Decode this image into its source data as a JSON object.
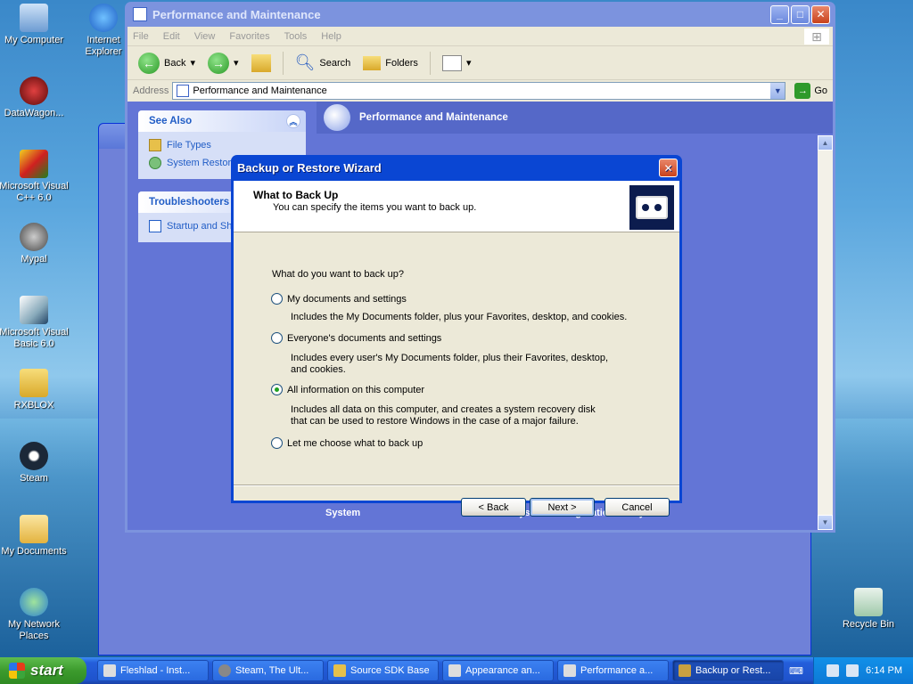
{
  "desktop": {
    "icons": [
      {
        "label": "My Computer"
      },
      {
        "label": "Internet Explorer"
      },
      {
        "label": "DataWagon..."
      },
      {
        "label": "Microsoft Visual C++ 6.0"
      },
      {
        "label": "Mypal"
      },
      {
        "label": "Microsoft Visual Basic 6.0"
      },
      {
        "label": "RXBLOX"
      },
      {
        "label": "Steam"
      },
      {
        "label": "My Documents"
      },
      {
        "label": "My Network Places"
      },
      {
        "label": "Recycle Bin"
      }
    ]
  },
  "explorer": {
    "title": "Performance and Maintenance",
    "menu": [
      "File",
      "Edit",
      "View",
      "Favorites",
      "Tools",
      "Help"
    ],
    "toolbar": {
      "back": "Back",
      "search": "Search",
      "folders": "Folders"
    },
    "address_label": "Address",
    "address_value": "Performance and Maintenance",
    "go_label": "Go",
    "see_also": {
      "title": "See Also",
      "items": [
        "File Types",
        "System Restore"
      ]
    },
    "troubleshooters": {
      "title": "Troubleshooters",
      "items": [
        "Startup and Shutdown"
      ]
    },
    "category_header": "Performance and Maintenance",
    "cut_items": [
      "System",
      "System Configuration Utility"
    ]
  },
  "wizard": {
    "title": "Backup or Restore Wizard",
    "heading": "What to Back Up",
    "subheading": "You can specify the items you want to back up.",
    "question": "What do you want to back up?",
    "options": [
      {
        "label": "My documents and settings",
        "desc": "Includes the My Documents folder, plus your Favorites, desktop, and cookies.",
        "selected": false
      },
      {
        "label": "Everyone's documents and settings",
        "desc": "Includes every user's My Documents folder, plus their Favorites, desktop, and cookies.",
        "selected": false
      },
      {
        "label": "All information on this computer",
        "desc": "Includes all data on this computer, and creates a system recovery disk that can be used to restore Windows in the case of a major failure.",
        "selected": true
      },
      {
        "label": "Let me choose what to back up",
        "desc": "",
        "selected": false
      }
    ],
    "buttons": {
      "back": "< Back",
      "next": "Next >",
      "cancel": "Cancel"
    }
  },
  "taskbar": {
    "start": "start",
    "tasks": [
      {
        "label": "Fleshlad - Inst..."
      },
      {
        "label": "Steam, The Ult..."
      },
      {
        "label": "Source SDK Base"
      },
      {
        "label": "Appearance an..."
      },
      {
        "label": "Performance a..."
      },
      {
        "label": "Backup or Rest..."
      }
    ],
    "clock": "6:14 PM"
  },
  "colors": {
    "xp_blue": "#0a46d3",
    "start_green": "#3c9b2d",
    "taskpane_blue": "#6375d6"
  }
}
